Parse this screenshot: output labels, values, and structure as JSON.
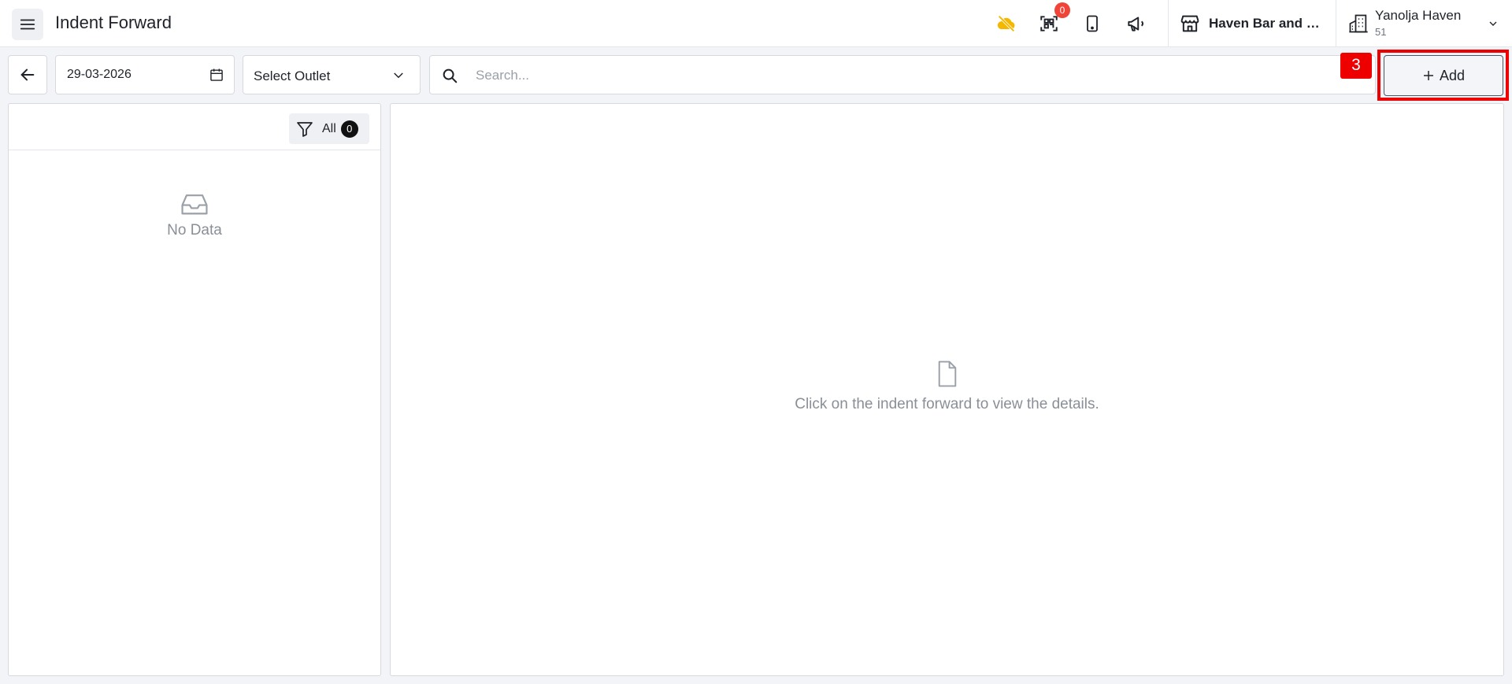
{
  "header": {
    "title": "Indent Forward",
    "qr_badge_count": "0",
    "outlet_name": "Haven Bar and R...",
    "user_name": "Yanolja Haven",
    "user_sub": "51",
    "icons": [
      "menu-icon",
      "cloud-off-icon",
      "qr-scan-icon",
      "mobile-icon",
      "megaphone-icon",
      "store-icon",
      "building-icon",
      "chevron-down-icon"
    ]
  },
  "toolbar": {
    "date_value": "29-03-2026",
    "outlet_select": "Select Outlet",
    "search_placeholder": "Search...",
    "step_marker": "3",
    "add_label": "Add"
  },
  "left_panel": {
    "filter_label": "All",
    "filter_count": "0",
    "empty_text": "No Data"
  },
  "right_panel": {
    "empty_text": "Click on the indent forward to view the details."
  },
  "colors": {
    "accent_red": "#ee0000",
    "badge_red": "#f04438",
    "cloud_yellow": "#f5b800"
  }
}
